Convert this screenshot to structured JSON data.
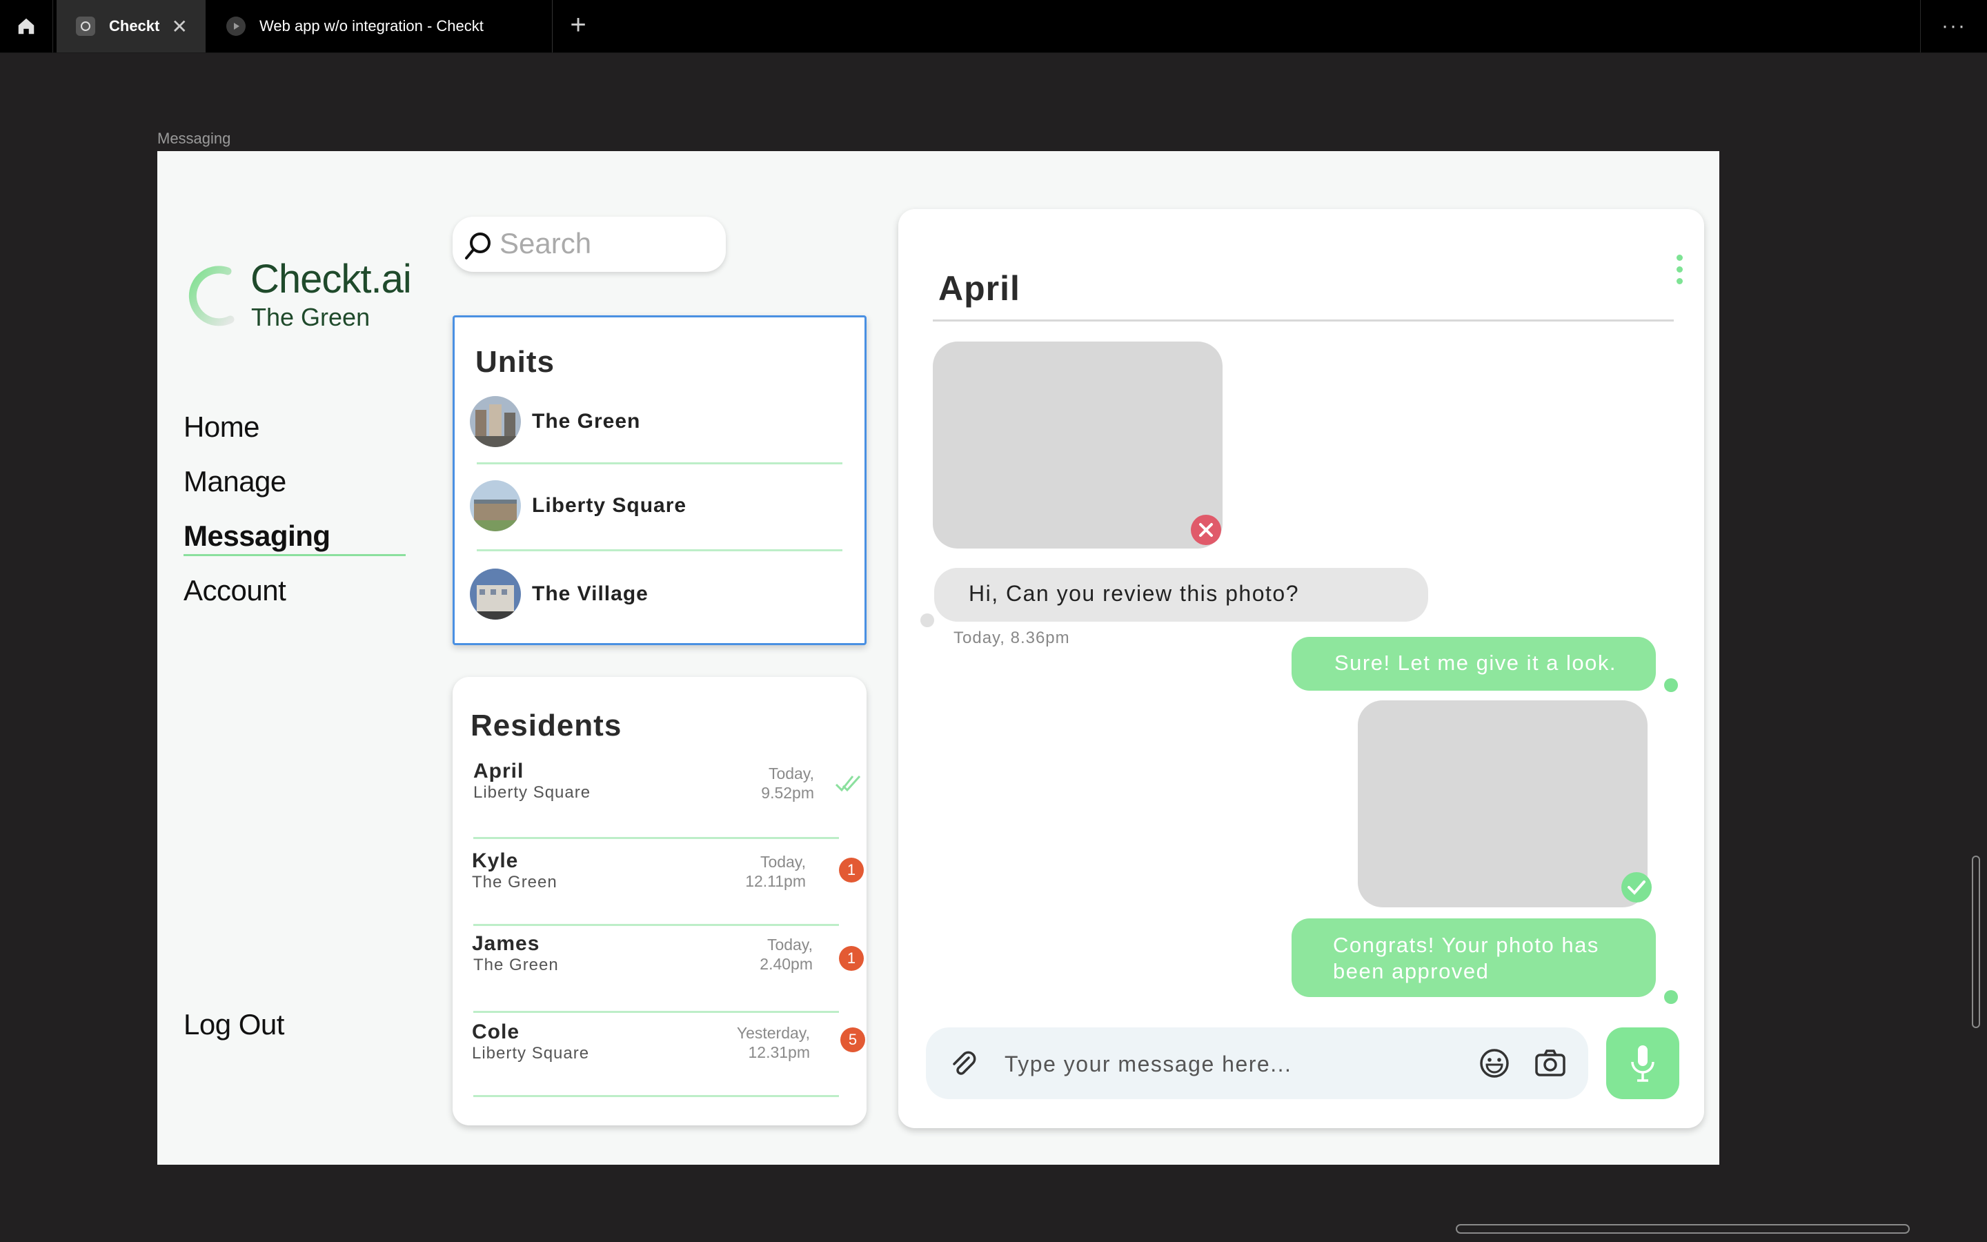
{
  "browser": {
    "tabs": [
      {
        "title": "Checkt",
        "active": true
      },
      {
        "title": "Web app w/o integration - Checkt",
        "active": false
      }
    ],
    "new_tab_label": "+",
    "more_label": "···",
    "frame_label": "Messaging"
  },
  "brand": {
    "name": "Checkt.ai",
    "property": "The Green",
    "accent_color": "#8be09e"
  },
  "nav": {
    "items": [
      {
        "label": "Home",
        "active": false
      },
      {
        "label": "Manage",
        "active": false
      },
      {
        "label": "Messaging",
        "active": true
      },
      {
        "label": "Account",
        "active": false
      }
    ],
    "logout_label": "Log Out"
  },
  "search": {
    "placeholder": "Search"
  },
  "units": {
    "title": "Units",
    "items": [
      {
        "name": "The Green"
      },
      {
        "name": "Liberty Square"
      },
      {
        "name": "The Village"
      }
    ]
  },
  "residents": {
    "title": "Residents",
    "items": [
      {
        "name": "April",
        "unit": "Liberty Square",
        "time_line1": "Today,",
        "time_line2": "9.52pm",
        "status": "read",
        "unread": null
      },
      {
        "name": "Kyle",
        "unit": "The Green",
        "time_line1": "Today,",
        "time_line2": "12.11pm",
        "status": "unread",
        "unread": "1"
      },
      {
        "name": "James",
        "unit": "The Green",
        "time_line1": "Today,",
        "time_line2": "2.40pm",
        "status": "unread",
        "unread": "1"
      },
      {
        "name": "Cole",
        "unit": "Liberty Square",
        "time_line1": "Yesterday,",
        "time_line2": "12.31pm",
        "status": "unread",
        "unread": "5"
      }
    ],
    "badge_color": "#e35a33"
  },
  "chat": {
    "contact_name": "April",
    "messages": [
      {
        "from": "resident",
        "type": "photo",
        "status": "rejected"
      },
      {
        "from": "resident",
        "type": "text",
        "text": "Hi, Can you review this photo?",
        "time": "Today, 8.36pm"
      },
      {
        "from": "manager",
        "type": "text",
        "text": "Sure! Let me give it a look."
      },
      {
        "from": "manager",
        "type": "photo",
        "status": "approved"
      },
      {
        "from": "manager",
        "type": "text",
        "text_line1": "Congrats! Your photo has",
        "text_line2": "been approved"
      }
    ],
    "composer_placeholder": "Type your message here...",
    "outgoing_color": "#8ee69d",
    "incoming_color": "#e6e6e6"
  },
  "icons": {
    "home": "home-icon",
    "close_tab": "close-icon",
    "search": "search-icon",
    "menu": "vertical-dots-icon",
    "attach": "paperclip-icon",
    "emoji": "smiley-icon",
    "camera": "camera-icon",
    "mic": "microphone-icon"
  }
}
